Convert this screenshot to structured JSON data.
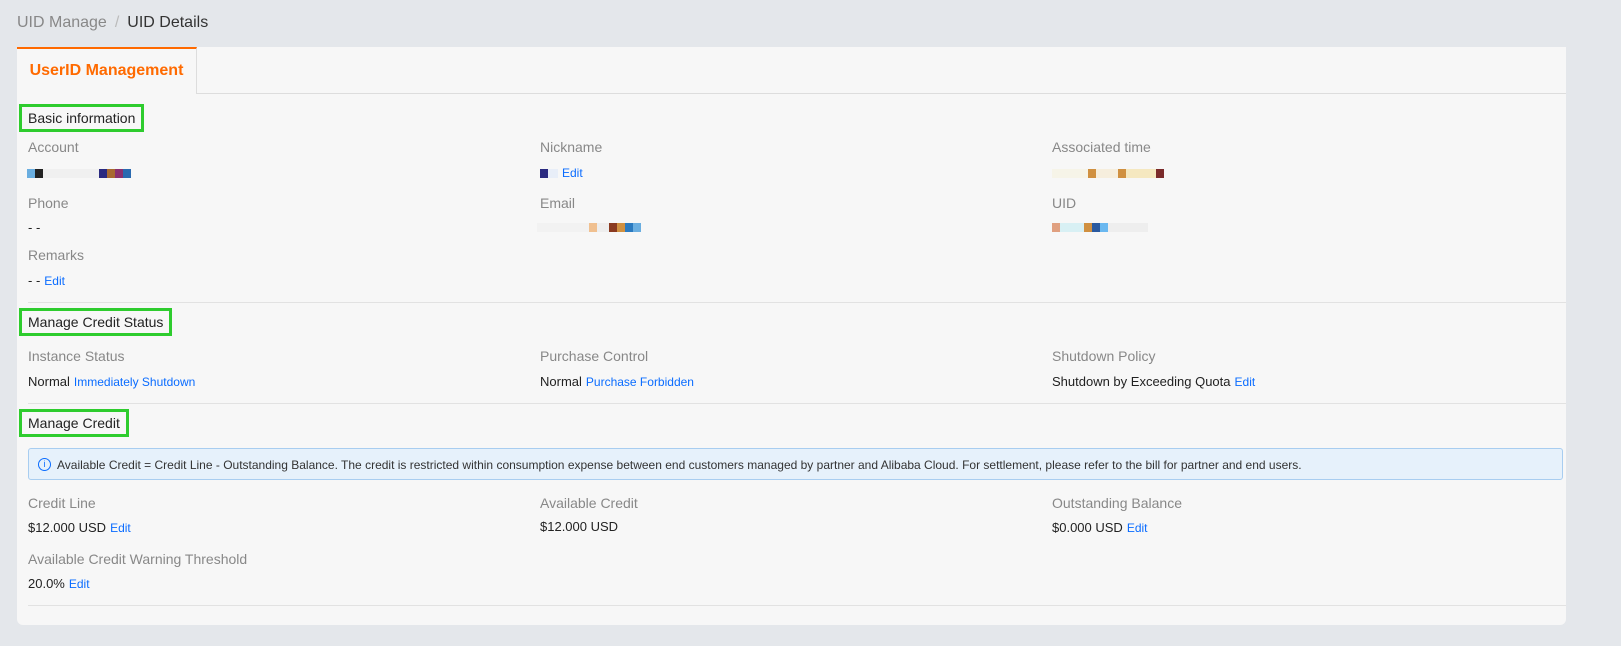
{
  "breadcrumb": {
    "parent": "UID Manage",
    "separator": "/",
    "current": "UID Details"
  },
  "tab": {
    "label": "UserID Management"
  },
  "basic": {
    "title": "Basic information",
    "account_label": "Account",
    "nickname_label": "Nickname",
    "associated_time_label": "Associated time",
    "phone_label": "Phone",
    "phone_value": "- -",
    "email_label": "Email",
    "uid_label": "UID",
    "remarks_label": "Remarks",
    "remarks_value": "- -",
    "edit": "Edit"
  },
  "credit_status": {
    "title": "Manage Credit Status",
    "instance_label": "Instance Status",
    "instance_value": "Normal",
    "instance_action": "Immediately Shutdown",
    "purchase_label": "Purchase Control",
    "purchase_value": "Normal",
    "purchase_action": "Purchase Forbidden",
    "shutdown_label": "Shutdown Policy",
    "shutdown_value": "Shutdown by Exceeding Quota",
    "edit": "Edit"
  },
  "credit": {
    "title": "Manage Credit",
    "notice": "Available Credit = Credit Line - Outstanding Balance. The credit is restricted within consumption expense between end customers managed by partner and Alibaba Cloud. For settlement, please refer to the bill for partner and end users.",
    "credit_line_label": "Credit Line",
    "credit_line_value": "$12.000 USD",
    "available_label": "Available Credit",
    "available_value": "$12.000 USD",
    "outstanding_label": "Outstanding Balance",
    "outstanding_value": "$0.000 USD",
    "threshold_label": "Available Credit Warning Threshold",
    "threshold_value": "20.0%",
    "edit": "Edit"
  }
}
